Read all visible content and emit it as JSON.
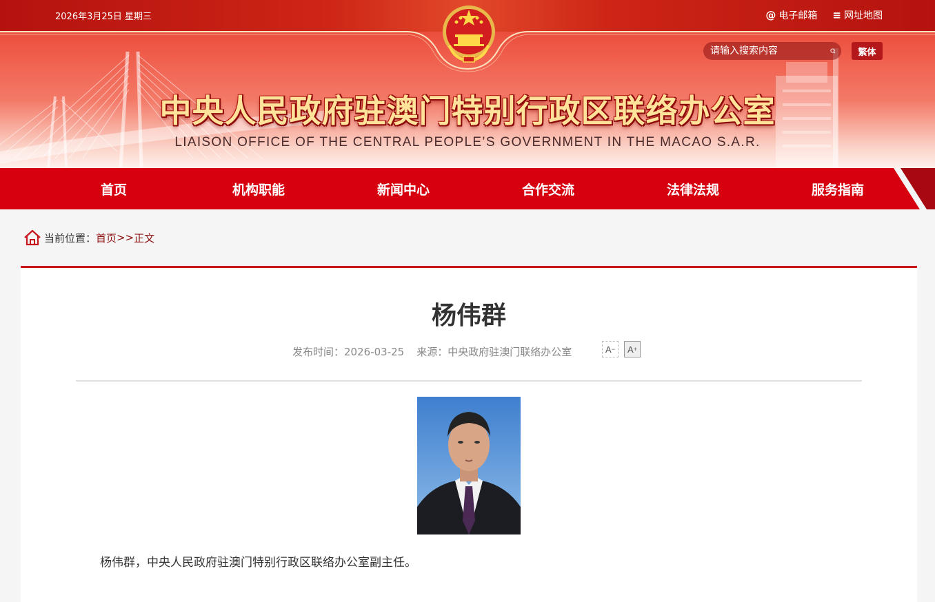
{
  "header": {
    "date": "2026年3月25日 星期三",
    "email_label": "电子邮箱",
    "sitemap_label": "网址地图",
    "search_placeholder": "请输入搜索内容",
    "traditional_label": "繁体",
    "title_cn": "中央人民政府驻澳门特别行政区联络办公室",
    "title_en": "LIAISON OFFICE OF THE CENTRAL PEOPLE’S GOVERNMENT IN THE MACAO S.A.R."
  },
  "nav": {
    "items": [
      {
        "label": "首页"
      },
      {
        "label": "机构职能"
      },
      {
        "label": "新闻中心"
      },
      {
        "label": "合作交流"
      },
      {
        "label": "法律法规"
      },
      {
        "label": "服务指南"
      }
    ]
  },
  "breadcrumb": {
    "prefix": "当前位置：",
    "home": "首页",
    "sep": ">>",
    "current": "正文"
  },
  "article": {
    "title": "杨伟群",
    "publish_label": "发布时间：",
    "publish_date": "2026-03-25",
    "source_label": "来源：",
    "source": "中央政府驻澳门联络办公室",
    "font_smaller": "A",
    "font_larger": "A",
    "body": "杨伟群，中央人民政府驻澳门特别行政区联络办公室副主任。"
  },
  "colors": {
    "nav_red": "#d7000f",
    "accent_red": "#c8161d",
    "link_dark_red": "#8c1010"
  }
}
